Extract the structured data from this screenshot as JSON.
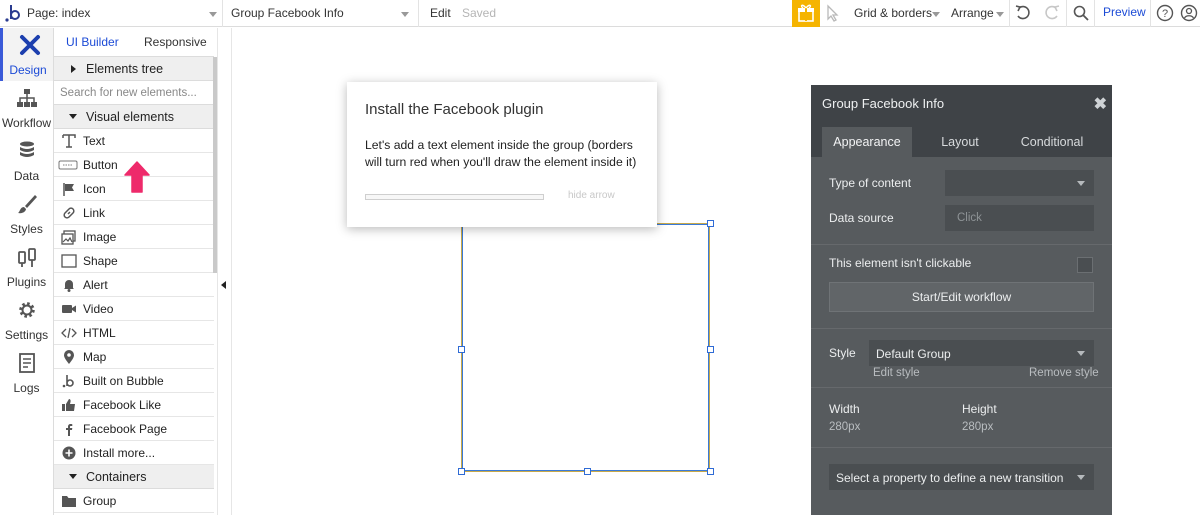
{
  "topbar": {
    "page_label": "Page: index",
    "element_label": "Group Facebook Info",
    "edit_label": "Edit",
    "saved_label": "Saved",
    "grid_label": "Grid & borders",
    "arrange_label": "Arrange",
    "preview_label": "Preview"
  },
  "nav": {
    "items": [
      {
        "label": "Design",
        "icon": "design-icon",
        "active": true
      },
      {
        "label": "Workflow",
        "icon": "workflow-icon"
      },
      {
        "label": "Data",
        "icon": "database-icon"
      },
      {
        "label": "Styles",
        "icon": "brush-icon"
      },
      {
        "label": "Plugins",
        "icon": "plug-icon"
      },
      {
        "label": "Settings",
        "icon": "gear-icon"
      },
      {
        "label": "Logs",
        "icon": "logs-icon"
      }
    ]
  },
  "panel": {
    "tab_ui_builder": "UI Builder",
    "tab_responsive": "Responsive",
    "elements_tree": "Elements tree",
    "search_placeholder": "Search for new elements...",
    "visual_elements": "Visual elements",
    "containers": "Containers",
    "items": [
      {
        "label": "Text",
        "icon": "text-icon"
      },
      {
        "label": "Button",
        "icon": "button-icon"
      },
      {
        "label": "Icon",
        "icon": "flag-icon"
      },
      {
        "label": "Link",
        "icon": "link-icon"
      },
      {
        "label": "Image",
        "icon": "image-icon"
      },
      {
        "label": "Shape",
        "icon": "shape-icon"
      },
      {
        "label": "Alert",
        "icon": "bell-icon"
      },
      {
        "label": "Video",
        "icon": "video-icon"
      },
      {
        "label": "HTML",
        "icon": "code-icon"
      },
      {
        "label": "Map",
        "icon": "map-pin-icon"
      },
      {
        "label": "Built on Bubble",
        "icon": "bubble-logo-icon"
      },
      {
        "label": "Facebook Like",
        "icon": "thumbs-up-icon"
      },
      {
        "label": "Facebook Page",
        "icon": "facebook-icon"
      },
      {
        "label": "Install more...",
        "icon": "plus-circle-icon"
      }
    ],
    "container_items": [
      {
        "label": "Group",
        "icon": "folder-icon"
      }
    ]
  },
  "popup": {
    "title": "Install the Facebook plugin",
    "body": "Let's add a text element inside the group (borders will turn red when you'll draw the element inside it)",
    "hide_arrow": "hide arrow"
  },
  "property_editor": {
    "title": "Group Facebook Info",
    "tabs": [
      "Appearance",
      "Layout",
      "Conditional"
    ],
    "type_of_content_label": "Type of content",
    "data_source_label": "Data source",
    "data_source_placeholder": "Click",
    "not_clickable_label": "This element isn't clickable",
    "workflow_button": "Start/Edit workflow",
    "style_label": "Style",
    "style_value": "Default Group",
    "edit_style": "Edit style",
    "remove_style": "Remove style",
    "width_label": "Width",
    "width_value": "280px",
    "height_label": "Height",
    "height_value": "280px",
    "transition_placeholder": "Select a property to define a new transition"
  },
  "colors": {
    "accent": "#1c4bd6",
    "gift": "#f5b400",
    "pink_arrow": "#ee2a6b",
    "panel_dark": "#575b5e"
  }
}
